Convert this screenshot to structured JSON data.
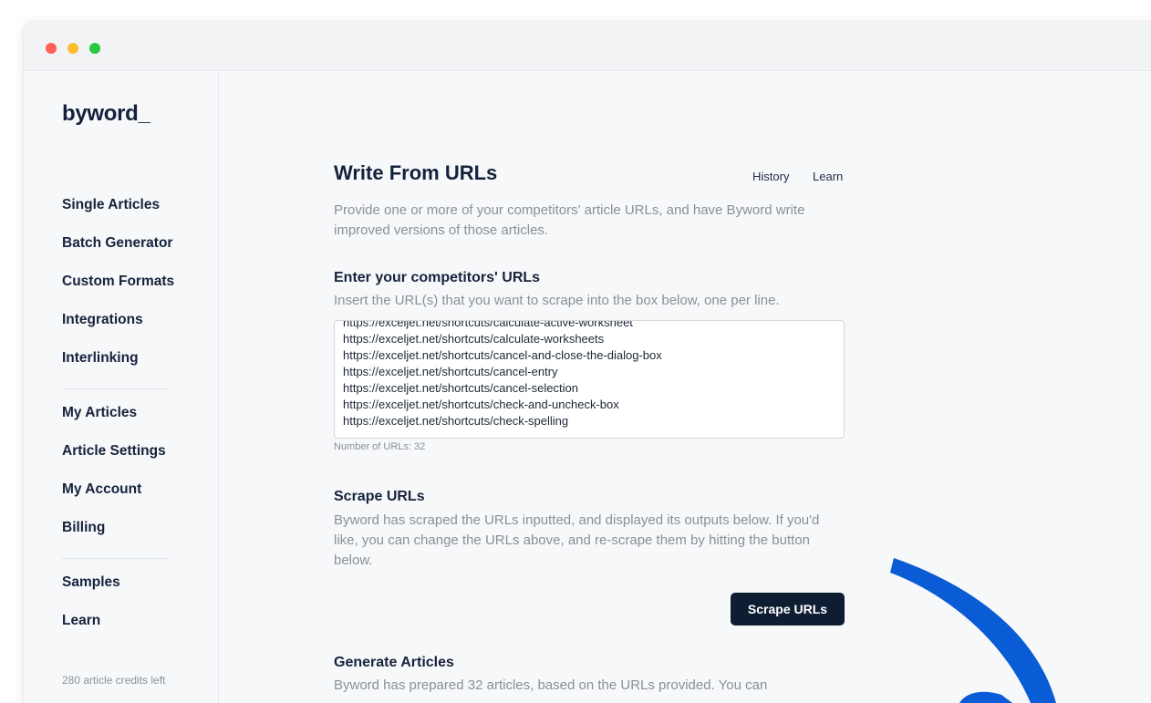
{
  "sidebar": {
    "logo": "byword_",
    "nav_group_1": [
      "Single Articles",
      "Batch Generator",
      "Custom Formats",
      "Integrations",
      "Interlinking"
    ],
    "nav_group_2": [
      "My Articles",
      "Article Settings",
      "My Account",
      "Billing"
    ],
    "nav_group_3": [
      "Samples",
      "Learn"
    ],
    "credits": "280 article credits left"
  },
  "header": {
    "title": "Write From URLs",
    "links": [
      "History",
      "Learn"
    ]
  },
  "intro": "Provide one or more of your competitors' article URLs, and have Byword write improved versions of those articles.",
  "urls_section": {
    "title": "Enter your competitors' URLs",
    "description": "Insert the URL(s) that you want to scrape into the box below, one per line.",
    "urls": [
      "https://exceljet.net/shortcuts/calculate-active-worksheet",
      "https://exceljet.net/shortcuts/calculate-worksheets",
      "https://exceljet.net/shortcuts/cancel-and-close-the-dialog-box",
      "https://exceljet.net/shortcuts/cancel-entry",
      "https://exceljet.net/shortcuts/cancel-selection",
      "https://exceljet.net/shortcuts/check-and-uncheck-box",
      "https://exceljet.net/shortcuts/check-spelling"
    ],
    "count_label": "Number of URLs: 32"
  },
  "scrape_section": {
    "title": "Scrape URLs",
    "description": "Byword has scraped the URLs inputted, and displayed its outputs below. If you'd like, you can change the URLs above, and re-scrape them by hitting the button below.",
    "button": "Scrape URLs"
  },
  "generate_section": {
    "title": "Generate Articles",
    "description": "Byword has prepared 32 articles, based on the URLs provided. You can"
  },
  "colors": {
    "primary": "#0f1d33",
    "arrow": "#0a5bd6"
  }
}
